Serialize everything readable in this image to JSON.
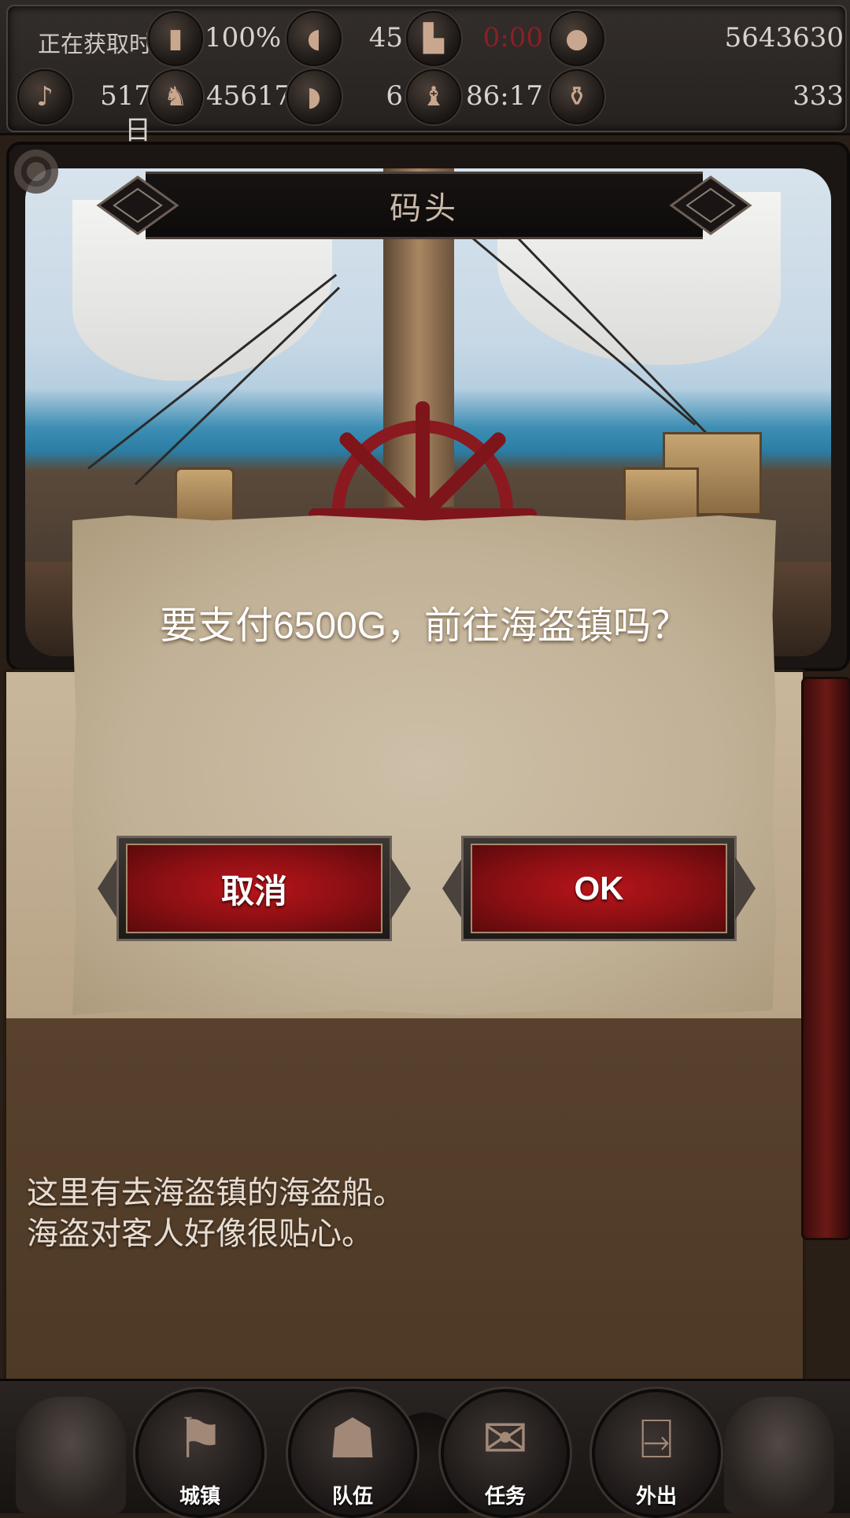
{
  "status": {
    "time_label": "正在获取时间",
    "row1": {
      "battery_pct": "100%",
      "meat": "45",
      "boot_time": "0:00",
      "gold": "5643630"
    },
    "row2": {
      "days": "517日",
      "fame": "45617",
      "meat_bone": "6",
      "clock": "86:17",
      "pots": "333"
    }
  },
  "scene": {
    "title": "码头"
  },
  "description": {
    "line1": "这里有去海盗镇的海盗船。",
    "line2": "海盗对客人好像很贴心。"
  },
  "dialog": {
    "message": "要支付6500G，前往海盗镇吗？",
    "cancel_label": "取消",
    "ok_label": "OK"
  },
  "nav": {
    "town": "城镇",
    "party": "队伍",
    "quest": "任务",
    "outing": "外出"
  },
  "colors": {
    "accent_red": "#8a0f13",
    "parchment": "#c1b196",
    "warning_text": "#8b1f24"
  }
}
